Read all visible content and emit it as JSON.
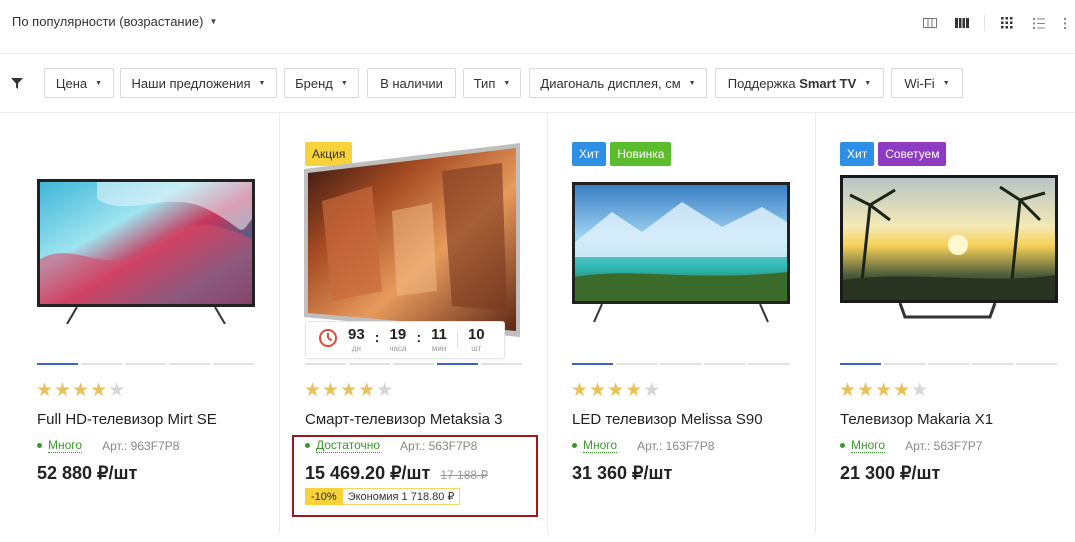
{
  "sort": {
    "label": "По популярности (возрастание)"
  },
  "view_icons": [
    "view-list-wide-icon",
    "view-grid-dense-icon",
    "view-grid-icon",
    "view-list-icon",
    "view-list-compact-icon"
  ],
  "filters": [
    {
      "label": "Цена",
      "dropdown": true
    },
    {
      "label": "Наши предложения",
      "dropdown": true
    },
    {
      "label": "Бренд",
      "dropdown": true
    },
    {
      "label": "В наличии",
      "dropdown": false
    },
    {
      "label": "Тип",
      "dropdown": true
    },
    {
      "label": "Диагональ дисплея, см",
      "dropdown": true
    },
    {
      "label_prefix": "Поддержка ",
      "label_bold": "Smart TV",
      "dropdown": true
    },
    {
      "label": "Wi-Fi",
      "dropdown": true
    }
  ],
  "colors": {
    "accent_blue": "#3d63c4",
    "star": "#e8c25c",
    "stock_green": "#3a9a2b",
    "badge_sale": "#f7d23a",
    "badge_hit": "#2e8fe6",
    "badge_new": "#5bbd2b",
    "badge_recommend": "#8e3bc4",
    "highlight": "#a1181a"
  },
  "products": [
    {
      "badges": [],
      "rating": 4,
      "title_prefix": "Full HD-телевизор ",
      "title_bold": "Mirt SE",
      "stock": "Много",
      "article": "Арт.: 963F7P8",
      "price": "52 880 ₽/шт"
    },
    {
      "badges": [
        {
          "text": "Акция",
          "type": "sale"
        }
      ],
      "timer": {
        "days": "93",
        "days_unit": "дн",
        "hours": "19",
        "hours_unit": "часа",
        "minutes": "11",
        "minutes_unit": "мин",
        "qty": "10",
        "qty_unit": "шт"
      },
      "rating": 4,
      "title_prefix": "Смарт-телевизор ",
      "title_bold": "Metaksia 3",
      "stock": "Достаточно",
      "article": "Арт.: 563F7P8",
      "price": "15 469.20 ₽/шт",
      "old_price": "17 188 ₽",
      "discount": "-10%",
      "economy": "Экономия 1 718.80 ₽"
    },
    {
      "badges": [
        {
          "text": "Хит",
          "type": "hit"
        },
        {
          "text": "Новинка",
          "type": "new"
        }
      ],
      "rating": 4,
      "title_prefix": "LED телевизор ",
      "title_bold": "Melissa S90",
      "stock": "Много",
      "article": "Арт.: 163F7P8",
      "price": "31 360 ₽/шт"
    },
    {
      "badges": [
        {
          "text": "Хит",
          "type": "hit"
        },
        {
          "text": "Советуем",
          "type": "recommend"
        }
      ],
      "rating": 4,
      "title_prefix": "Телевизор ",
      "title_bold": "Makaria X1",
      "stock": "Много",
      "article": "Арт.: 563F7P7",
      "price": "21 300 ₽/шт"
    }
  ]
}
